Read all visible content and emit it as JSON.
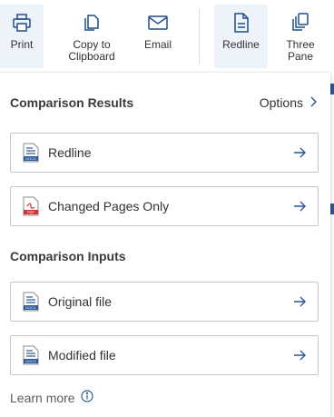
{
  "toolbar": {
    "print_label": "Print",
    "copy_label_line1": "Copy to",
    "copy_label_line2": "Clipboard",
    "email_label": "Email",
    "redline_label": "Redline",
    "three_pane_line1": "Three",
    "three_pane_line2": "Pane"
  },
  "panel": {
    "results_title": "Comparison Results",
    "options_label": "Options",
    "results_items": [
      {
        "label": "Redline",
        "icon": "docx-icon"
      },
      {
        "label": "Changed Pages Only",
        "icon": "pdf-icon"
      }
    ],
    "inputs_title": "Comparison Inputs",
    "input_items": [
      {
        "label": "Original file",
        "icon": "docx-icon"
      },
      {
        "label": "Modified file",
        "icon": "docx-icon"
      }
    ],
    "learn_more": "Learn more"
  },
  "colors": {
    "accent": "#2b579a",
    "pdf_red": "#d13438",
    "selected_bg": "#eef3f9"
  }
}
